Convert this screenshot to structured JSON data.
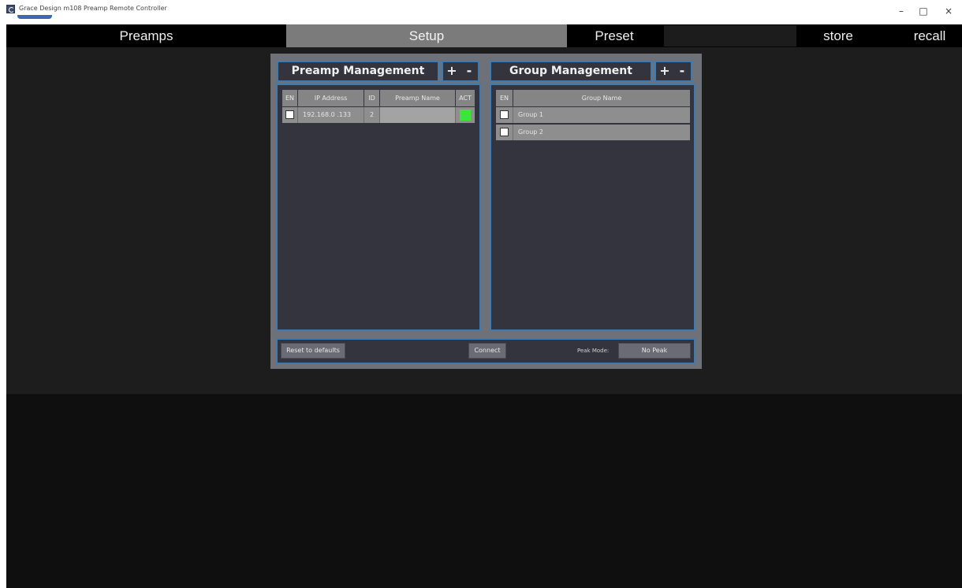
{
  "window": {
    "title": "Grace Design m108 Preamp Remote Controller",
    "controls": {
      "minimize": "–",
      "maximize": "□",
      "close": "×"
    }
  },
  "nav": {
    "preamps": "Preamps",
    "setup": "Setup",
    "preset": "Preset",
    "preset_value": "",
    "store": "store",
    "recall": "recall"
  },
  "preamp_management": {
    "title": "Preamp Management",
    "add": "+",
    "remove": "-",
    "columns": [
      "EN",
      "IP Address",
      "ID",
      "Preamp Name",
      "ACT"
    ],
    "rows": [
      {
        "en": false,
        "ip": "192.168.0 .133",
        "id": "2",
        "name": "",
        "act": true
      }
    ]
  },
  "group_management": {
    "title": "Group Management",
    "add": "+",
    "remove": "-",
    "columns": [
      "EN",
      "Group Name"
    ],
    "rows": [
      {
        "en": false,
        "name": "Group 1"
      },
      {
        "en": false,
        "name": "Group 2"
      }
    ]
  },
  "footer": {
    "reset": "Reset to defaults",
    "connect": "Connect",
    "peak_mode_label": "Peak Mode:",
    "peak_mode_value": "No Peak"
  },
  "colors": {
    "accent_border": "#3f7ab0",
    "act_indicator": "#39e639",
    "nav_active": "#7b7b7b"
  }
}
